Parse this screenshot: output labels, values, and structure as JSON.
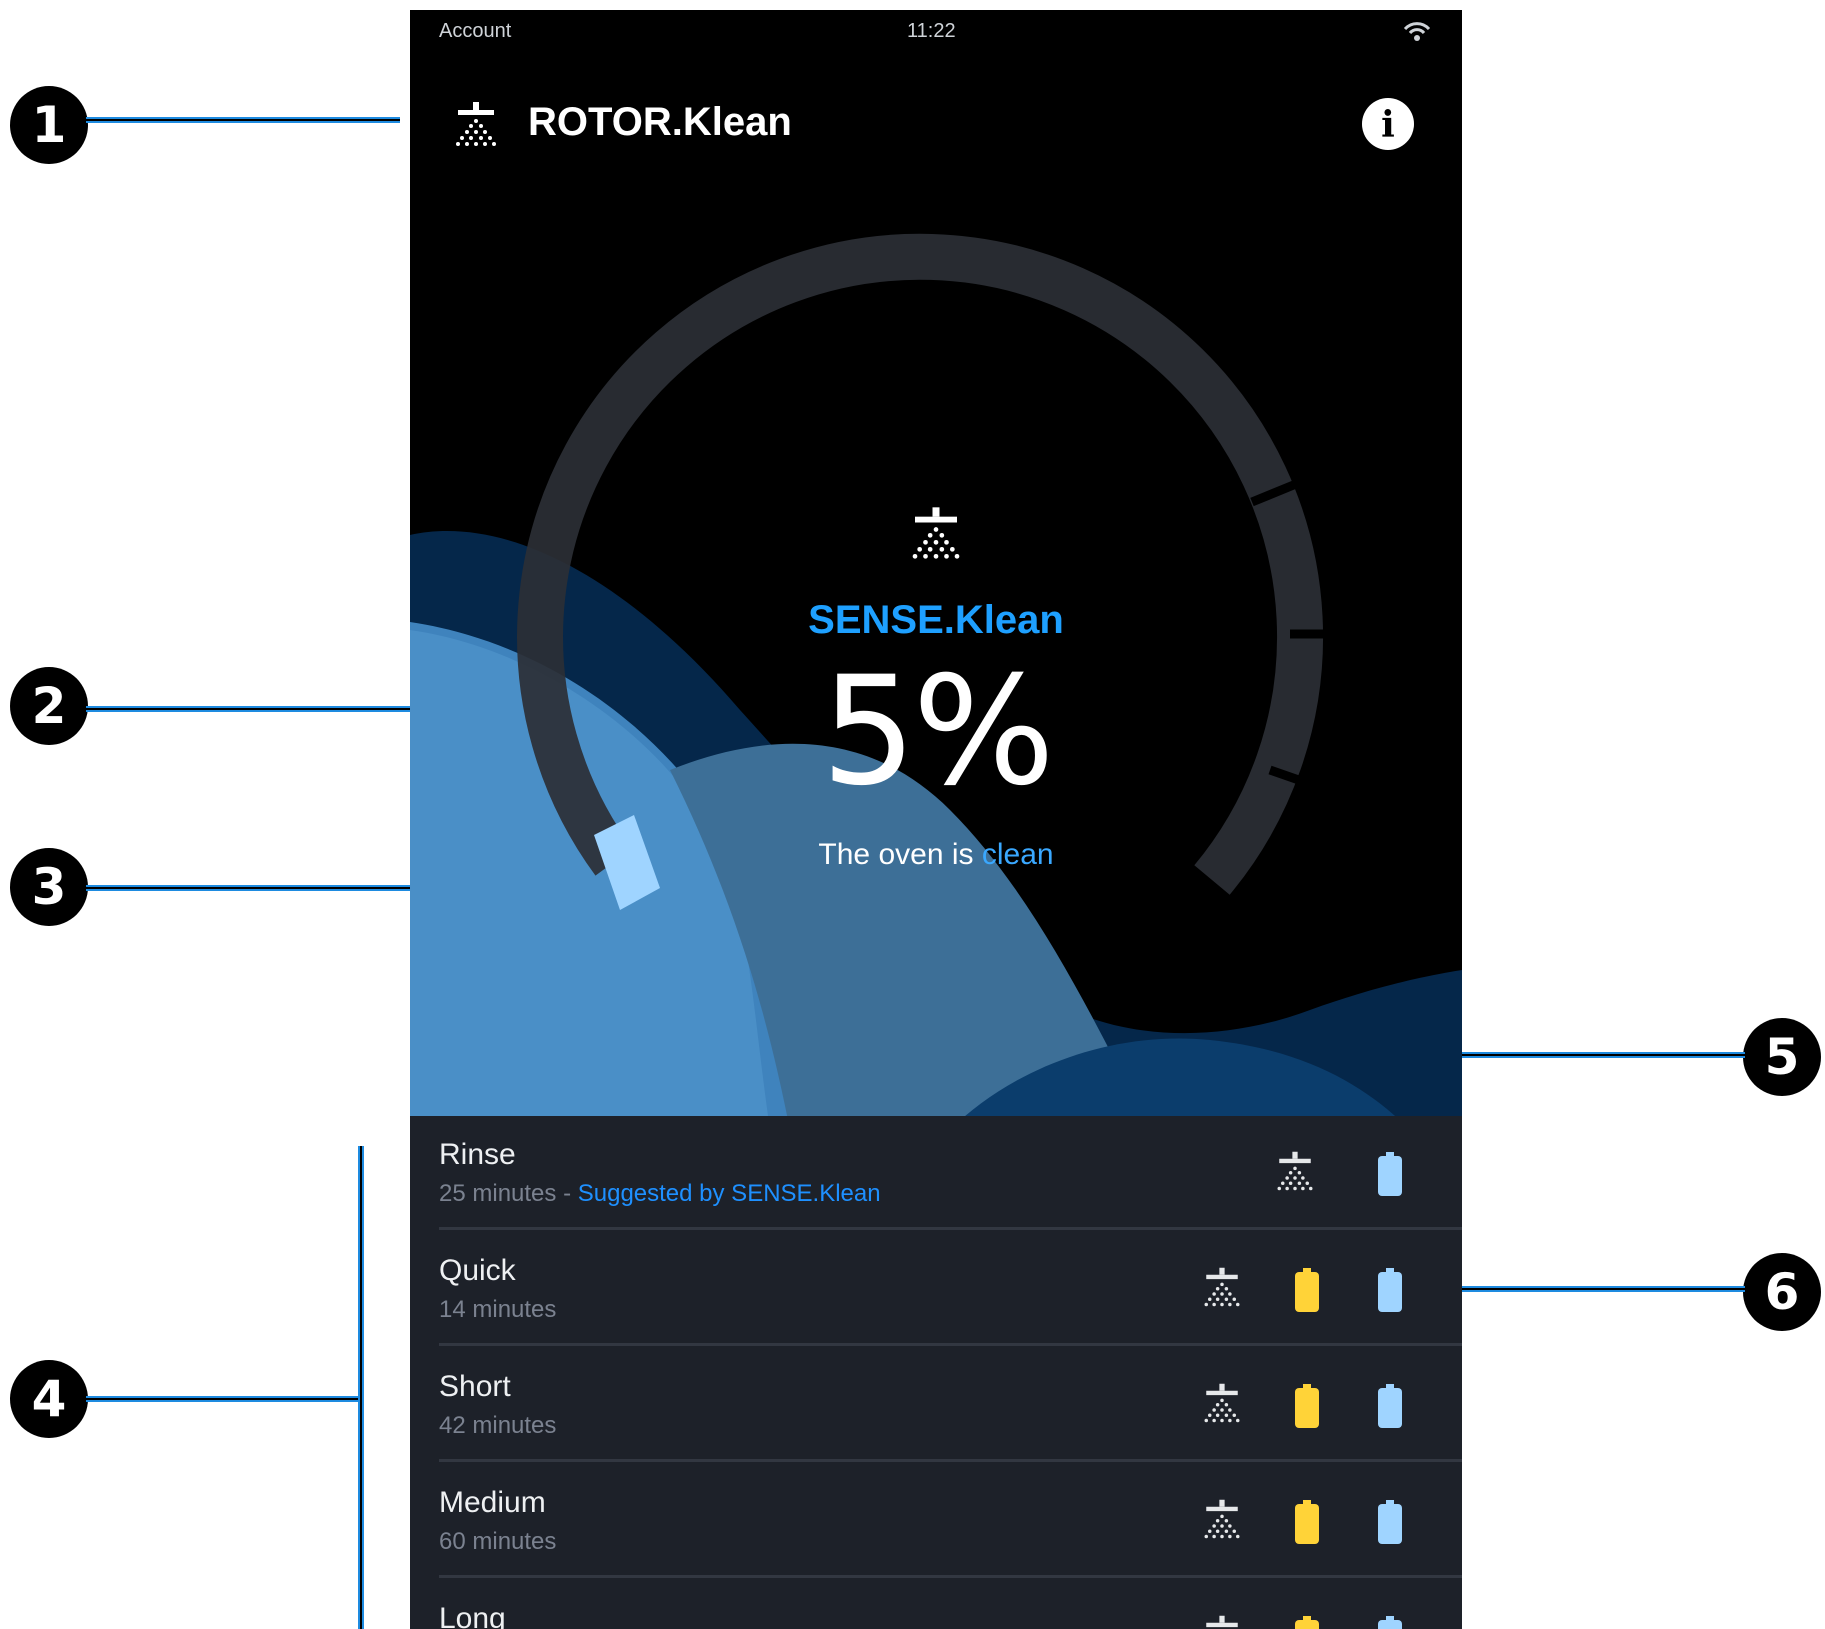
{
  "callouts": [
    "1",
    "2",
    "3",
    "4",
    "5",
    "6"
  ],
  "status_bar": {
    "left": "Account",
    "time": "11:22"
  },
  "app_bar": {
    "title": "ROTOR.Klean",
    "info_glyph": "i"
  },
  "hero": {
    "sense_label": "SENSE.Klean",
    "percent": "5%",
    "state_prefix": "The oven is ",
    "state_value": "clean",
    "gauge_fill_fraction": 0.05
  },
  "programs": [
    {
      "name": "Rinse",
      "duration": "25 minutes",
      "suggestion_sep": " - ",
      "suggestion": "Suggested by SENSE.Klean",
      "icons": [
        "shower-icon",
        "battery-blue-icon"
      ]
    },
    {
      "name": "Quick",
      "duration": "14 minutes",
      "icons": [
        "shower-icon",
        "battery-yellow-icon",
        "battery-blue-icon"
      ]
    },
    {
      "name": "Short",
      "duration": "42 minutes",
      "icons": [
        "shower-icon",
        "battery-yellow-icon",
        "battery-blue-icon"
      ]
    },
    {
      "name": "Medium",
      "duration": "60 minutes",
      "icons": [
        "shower-icon",
        "battery-yellow-icon",
        "battery-blue-icon"
      ]
    },
    {
      "name": "Long",
      "duration": "",
      "icons": [
        "shower-icon",
        "battery-yellow-icon",
        "battery-blue-icon"
      ]
    }
  ],
  "colors": {
    "accent": "#1ea0ff",
    "list_bg": "#1d2129",
    "battery_yellow": "#ffd338",
    "battery_blue": "#9fd4ff",
    "wave_light": "#4a8fc7",
    "wave_dark": "#05274a"
  }
}
